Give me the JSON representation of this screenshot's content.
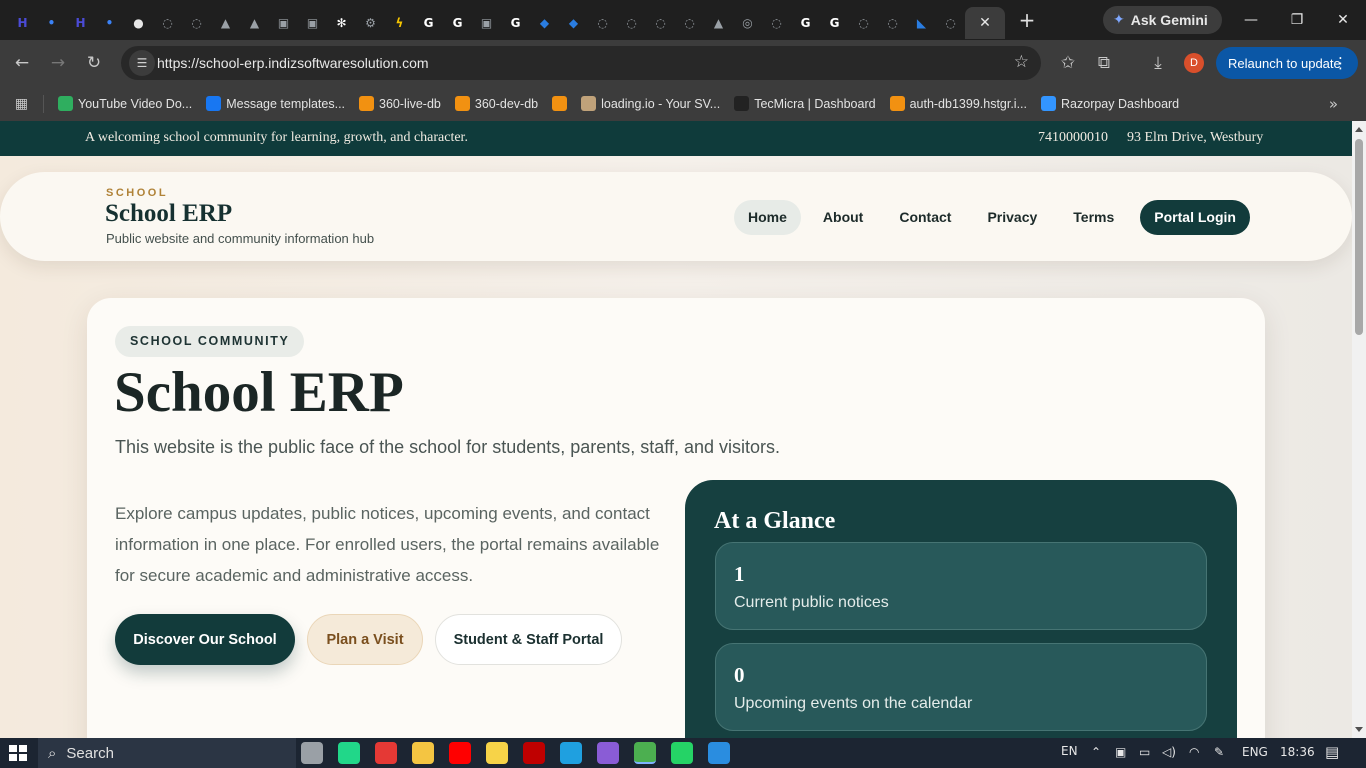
{
  "browser": {
    "tab_favicons": [
      {
        "icon": "h-icon",
        "color": "#4b4bd6",
        "glyph": "H"
      },
      {
        "icon": "app-icon",
        "color": "#3b82f6",
        "glyph": "•"
      },
      {
        "icon": "h-icon",
        "color": "#4b4bd6",
        "glyph": "H"
      },
      {
        "icon": "app-icon",
        "color": "#3b82f6",
        "glyph": "•"
      },
      {
        "icon": "github-icon",
        "color": "#e6e6e6",
        "glyph": "●"
      },
      {
        "icon": "globe-icon",
        "color": "#9aa0a6",
        "glyph": "◌"
      },
      {
        "icon": "globe-icon",
        "color": "#9aa0a6",
        "glyph": "◌"
      },
      {
        "icon": "mountain-icon",
        "color": "#9aa0a6",
        "glyph": "▲"
      },
      {
        "icon": "mountain-icon",
        "color": "#9aa0a6",
        "glyph": "▲"
      },
      {
        "icon": "box-icon",
        "color": "#9aa0a6",
        "glyph": "▣"
      },
      {
        "icon": "box-icon",
        "color": "#9aa0a6",
        "glyph": "▣"
      },
      {
        "icon": "openai-icon",
        "color": "#ffffff",
        "glyph": "✻"
      },
      {
        "icon": "gear-icon",
        "color": "#9aa0a6",
        "glyph": "⚙"
      },
      {
        "icon": "bolt-icon",
        "color": "#f5c400",
        "glyph": "ϟ"
      },
      {
        "icon": "google-icon",
        "color": "#ffffff",
        "glyph": "G"
      },
      {
        "icon": "google-icon",
        "color": "#ffffff",
        "glyph": "G"
      },
      {
        "icon": "box-icon",
        "color": "#9aa0a6",
        "glyph": "▣"
      },
      {
        "icon": "google-icon",
        "color": "#ffffff",
        "glyph": "G"
      },
      {
        "icon": "code-icon",
        "color": "#2a7de1",
        "glyph": "◆"
      },
      {
        "icon": "code-icon",
        "color": "#2a7de1",
        "glyph": "◆"
      },
      {
        "icon": "globe-icon",
        "color": "#9aa0a6",
        "glyph": "◌"
      },
      {
        "icon": "globe-icon",
        "color": "#9aa0a6",
        "glyph": "◌"
      },
      {
        "icon": "globe-icon",
        "color": "#9aa0a6",
        "glyph": "◌"
      },
      {
        "icon": "globe-icon",
        "color": "#9aa0a6",
        "glyph": "◌"
      },
      {
        "icon": "mountain-icon",
        "color": "#9aa0a6",
        "glyph": "▲"
      },
      {
        "icon": "chrome-icon",
        "color": "#9aa0a6",
        "glyph": "◎"
      },
      {
        "icon": "globe-icon",
        "color": "#9aa0a6",
        "glyph": "◌"
      },
      {
        "icon": "google-icon",
        "color": "#ffffff",
        "glyph": "G"
      },
      {
        "icon": "google-icon",
        "color": "#ffffff",
        "glyph": "G"
      },
      {
        "icon": "globe-icon",
        "color": "#9aa0a6",
        "glyph": "◌"
      },
      {
        "icon": "globe-icon",
        "color": "#9aa0a6",
        "glyph": "◌"
      },
      {
        "icon": "bird-icon",
        "color": "#2a7de1",
        "glyph": "◣"
      },
      {
        "icon": "globe-icon",
        "color": "#9aa0a6",
        "glyph": "◌"
      }
    ],
    "ask_gemini": "Ask Gemini",
    "url": "https://school-erp.indizsoftwaresolution.com",
    "profile_initial": "D",
    "relaunch_label": "Relaunch to update",
    "bookmarks": [
      {
        "label": "YouTube Video Do...",
        "color": "#2fae5f"
      },
      {
        "label": "Message templates...",
        "color": "#1877f2"
      },
      {
        "label": "360-live-db",
        "color": "#f29111"
      },
      {
        "label": "360-dev-db",
        "color": "#f29111"
      },
      {
        "label": "",
        "color": "#f29111"
      },
      {
        "label": "loading.io - Your SV...",
        "color": "#c0a27a"
      },
      {
        "label": "TecMicra | Dashboard",
        "color": "#222222"
      },
      {
        "label": "auth-db1399.hstgr.i...",
        "color": "#f29111"
      },
      {
        "label": "Razorpay Dashboard",
        "color": "#3395ff"
      }
    ]
  },
  "site": {
    "topbar": {
      "tagline": "A welcoming school community for learning, growth, and character.",
      "phone": "7410000010",
      "address": "93 Elm Drive, Westbury"
    },
    "brand": {
      "kicker": "SCHOOL",
      "name": "School ERP",
      "subtitle": "Public website and community information hub"
    },
    "nav": {
      "home": "Home",
      "about": "About",
      "contact": "Contact",
      "privacy": "Privacy",
      "terms": "Terms",
      "login": "Portal Login"
    },
    "hero": {
      "pill": "SCHOOL COMMUNITY",
      "title": "School ERP",
      "lead": "This website is the public face of the school for students, parents, staff, and visitors.",
      "body": "Explore campus updates, public notices, upcoming events, and contact information in one place. For enrolled users, the portal remains available for secure academic and administrative access.",
      "buttons": {
        "discover": "Discover Our School",
        "visit": "Plan a Visit",
        "portal": "Student & Staff Portal"
      }
    },
    "glance": {
      "title": "At a Glance",
      "stats": [
        {
          "value": "1",
          "label": "Current public notices"
        },
        {
          "value": "0",
          "label": "Upcoming events on the calendar"
        }
      ]
    },
    "colors": {
      "primary": "#123b3b",
      "accent": "#b08237",
      "glance_bg": "#164040"
    }
  },
  "taskbar": {
    "search_label": "Search",
    "lang_short": "EN",
    "lang": "ENG",
    "time": "18:36",
    "apps": [
      {
        "icon": "task-view-icon",
        "color": "#9aa0a6"
      },
      {
        "icon": "pycharm-icon",
        "color": "#21d789"
      },
      {
        "icon": "record-icon",
        "color": "#e53935"
      },
      {
        "icon": "file-explorer-icon",
        "color": "#f4c542"
      },
      {
        "icon": "youtube-icon",
        "color": "#ff0000"
      },
      {
        "icon": "sticky-notes-icon",
        "color": "#f7d348"
      },
      {
        "icon": "filezilla-icon",
        "color": "#bf0000"
      },
      {
        "icon": "edge-icon",
        "color": "#1fa0e0"
      },
      {
        "icon": "github-desktop-icon",
        "color": "#8a5cd6"
      },
      {
        "icon": "chrome-icon",
        "color": "#4caf50"
      },
      {
        "icon": "whatsapp-icon",
        "color": "#25d366"
      },
      {
        "icon": "vscode-icon",
        "color": "#2a8de0"
      }
    ]
  }
}
